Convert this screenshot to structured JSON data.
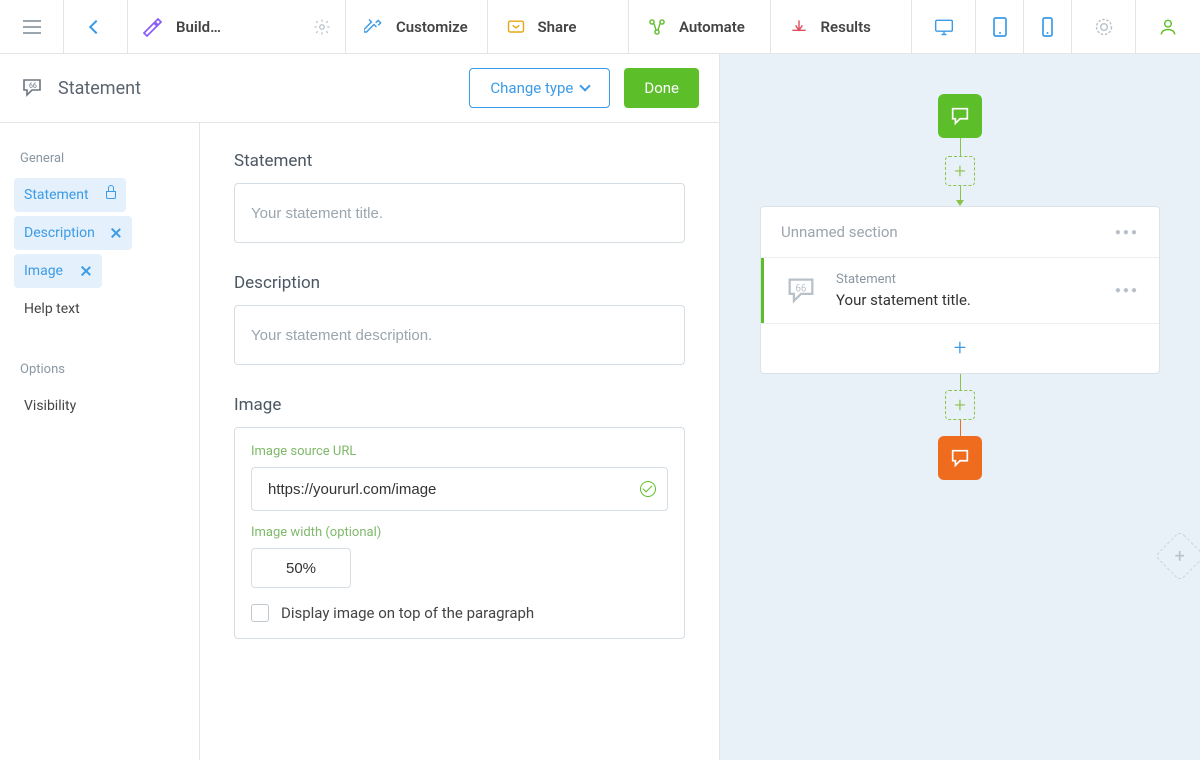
{
  "topnav": {
    "build": "Build…",
    "customize": "Customize",
    "share": "Share",
    "automate": "Automate",
    "results": "Results"
  },
  "panel": {
    "title": "Statement",
    "change_type": "Change type",
    "done": "Done"
  },
  "sidebar": {
    "group_general": "General",
    "items": {
      "statement": "Statement",
      "description": "Description",
      "image": "Image",
      "help_text": "Help text"
    },
    "group_options": "Options",
    "visibility": "Visibility"
  },
  "form": {
    "statement_label": "Statement",
    "statement_placeholder": "Your statement title.",
    "description_label": "Description",
    "description_placeholder": "Your statement description.",
    "image_label": "Image",
    "image_url_label": "Image source URL",
    "image_url_value": "https://yoururl.com/image",
    "image_width_label": "Image width (optional)",
    "image_width_value": "50%",
    "image_on_top_label": "Display image on top of the paragraph"
  },
  "canvas": {
    "section_title": "Unnamed section",
    "card_type": "Statement",
    "card_title": "Your statement title."
  }
}
